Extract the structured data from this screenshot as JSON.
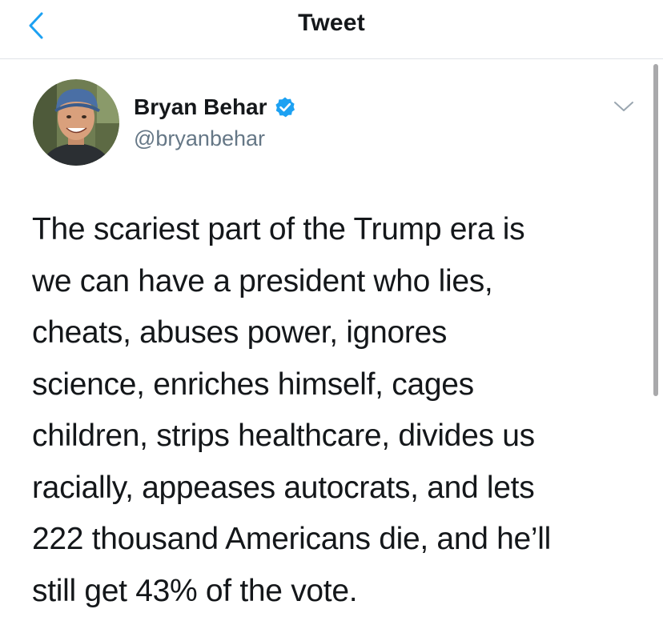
{
  "header": {
    "title": "Tweet",
    "back_icon": "chevron-left-icon"
  },
  "author": {
    "display_name": "Bryan Behar",
    "handle": "@bryanbehar",
    "verified": true,
    "verified_icon": "verified-badge-icon"
  },
  "menu": {
    "icon": "chevron-down-icon"
  },
  "tweet": {
    "text": "The scariest part of the Trump era is\nwe can have a president who lies,\ncheats, abuses power, ignores\nscience, enriches himself, cages\nchildren, strips healthcare, divides us\nracially, appeases autocrats, and lets\n222 thousand Americans die, and he’ll\nstill get 43% of the vote."
  },
  "colors": {
    "accent": "#1da1f2",
    "text": "#14171a",
    "secondary_text": "#657786",
    "divider": "#dfe3e7"
  }
}
